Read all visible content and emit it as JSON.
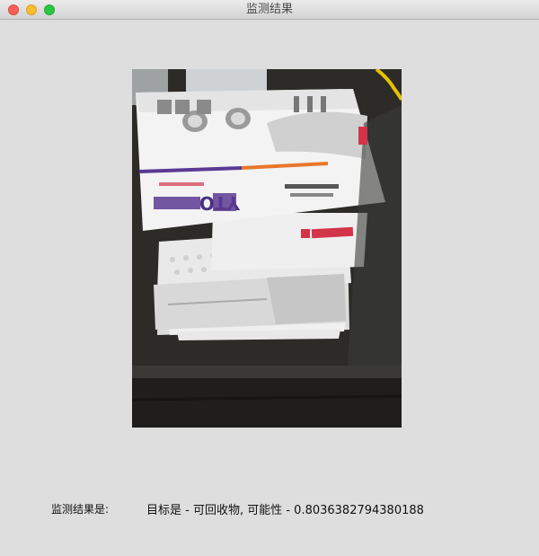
{
  "window": {
    "title": "监测结果"
  },
  "image": {
    "description_icon": "parcel-stack-image"
  },
  "result": {
    "label": "监测结果是:",
    "text": "目标是 - 可回收物, 可能性 - 0.8036382794380188"
  },
  "colors": {
    "close": "#fc5f57",
    "minimize": "#fdbc2e",
    "maximize": "#28c840",
    "background": "#dedede"
  }
}
